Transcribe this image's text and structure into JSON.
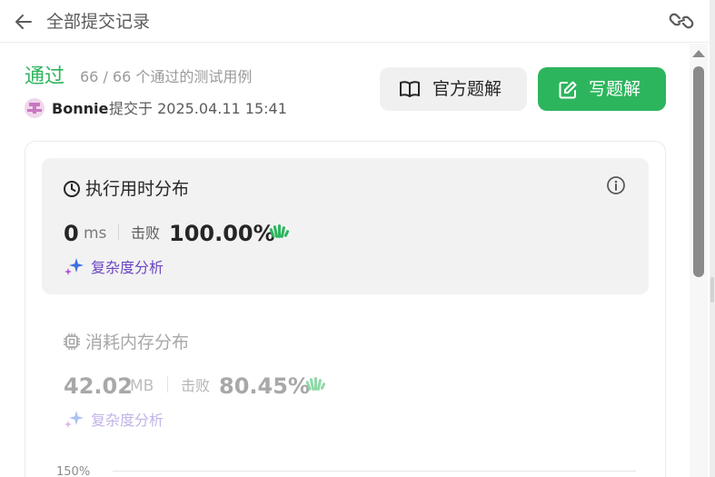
{
  "header": {
    "title": "全部提交记录",
    "back_icon": "arrow-left-icon",
    "link_icon": "link-icon"
  },
  "submission": {
    "status": "通过",
    "testcases": "66 / 66 个通过的测试用例",
    "username": "Bonnie",
    "submitted_text": "提交于 2025.04.11 15:41"
  },
  "actions": {
    "official_solution": "官方题解",
    "write_solution": "写题解"
  },
  "runtime": {
    "title": "执行用时分布",
    "value": "0",
    "unit": "ms",
    "beats_label": "击败",
    "beats": "100.00%",
    "complexity_link": "复杂度分析"
  },
  "memory": {
    "title": "消耗内存分布",
    "value": "42.02",
    "unit": "MB",
    "beats_label": "击败",
    "beats": "80.45%",
    "complexity_link": "复杂度分析"
  },
  "chart": {
    "y_tick_top": "150%"
  },
  "colors": {
    "accent_green": "#2db55d",
    "complexity_purple": "#6b46c1",
    "card_bg": "#f2f2f3"
  }
}
